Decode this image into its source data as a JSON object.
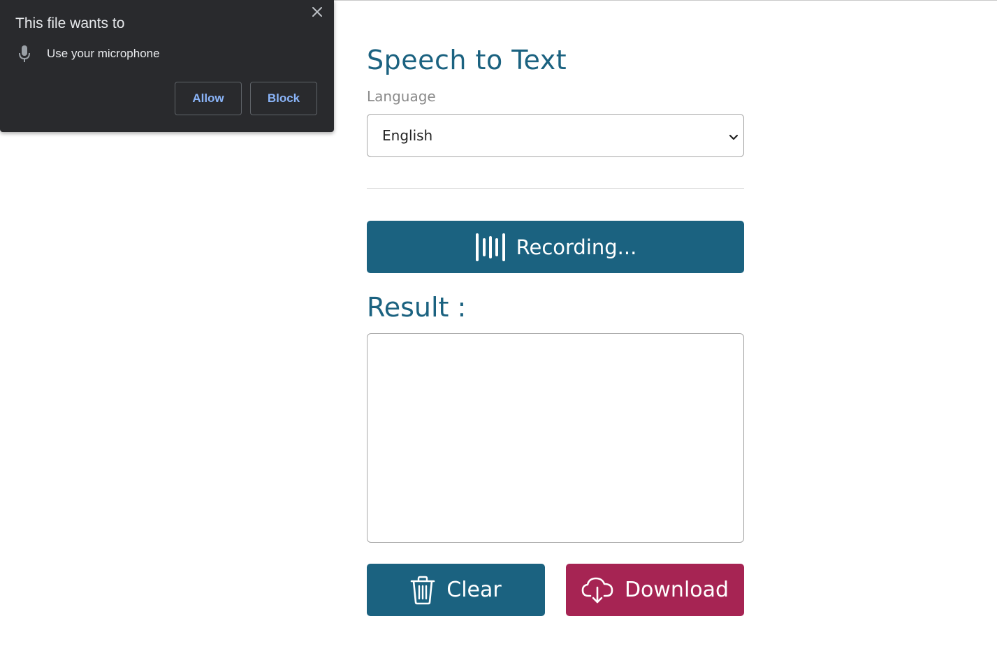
{
  "permission_popup": {
    "title": "This file wants to",
    "permission_text": "Use your microphone",
    "allow_label": "Allow",
    "block_label": "Block",
    "close_icon": "close-icon",
    "mic_icon": "microphone-icon"
  },
  "main": {
    "title": "Speech to Text",
    "language_label": "Language",
    "language_selected": "English",
    "record_label": "Recording...",
    "record_icon": "sound-wave-icon",
    "result_title": "Result :",
    "result_text": "",
    "clear_label": "Clear",
    "clear_icon": "trash-icon",
    "download_label": "Download",
    "download_icon": "cloud-download-icon"
  },
  "colors": {
    "primary": "#1b6280",
    "accent": "#a62453",
    "popup_bg": "#292a2d",
    "popup_link": "#8ab4f8"
  }
}
